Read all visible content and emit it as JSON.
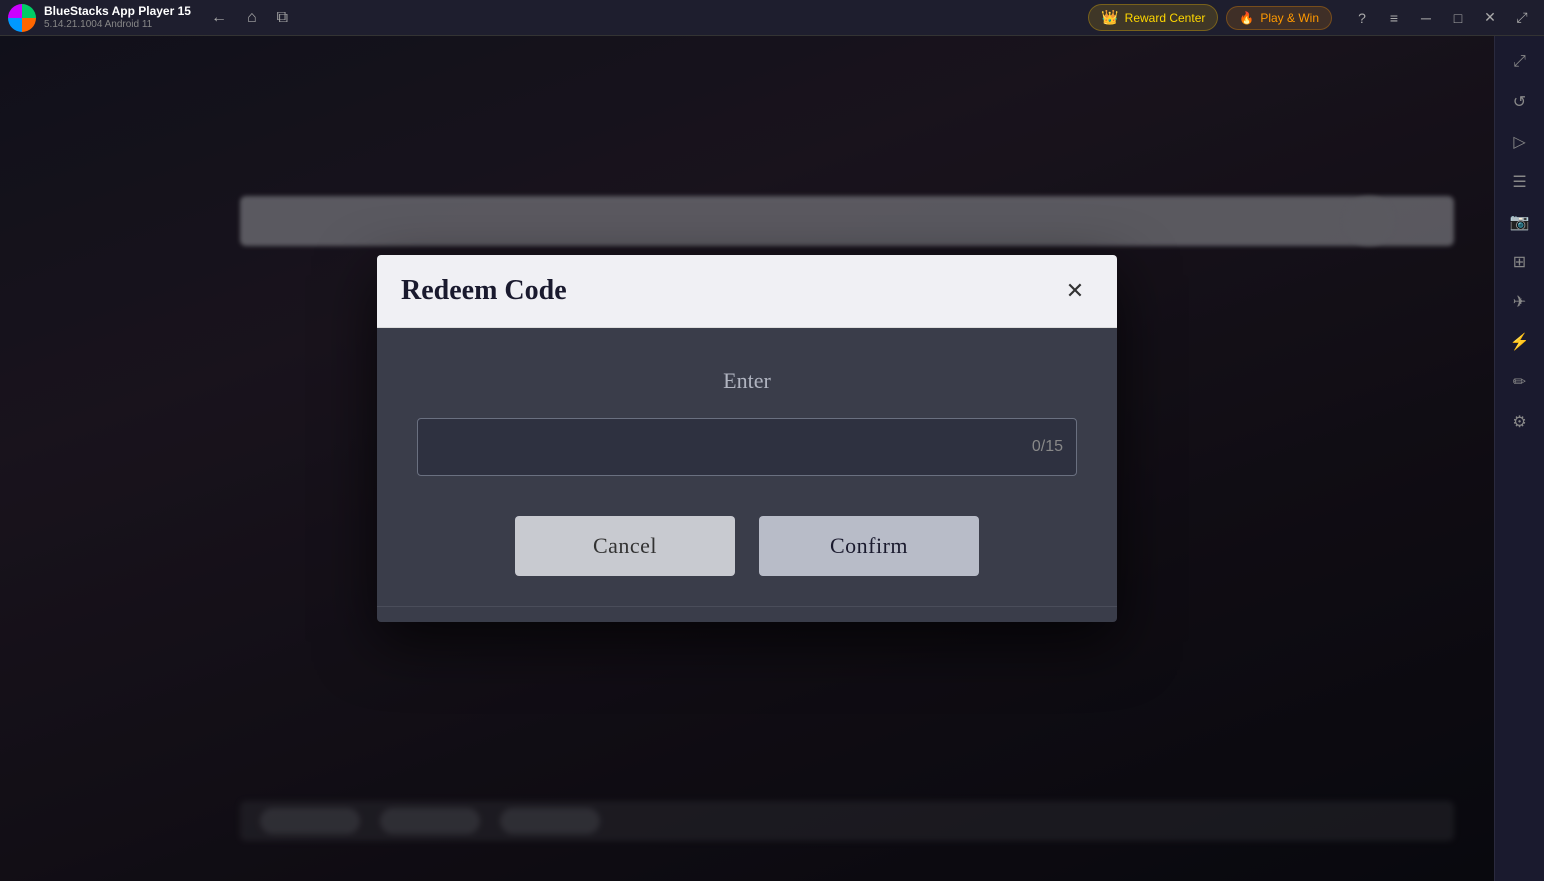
{
  "titlebar": {
    "app_name": "BlueStacks App Player 15",
    "version": "5.14.21.1004  Android 11",
    "reward_center_label": "Reward Center",
    "play_win_label": "Play & Win",
    "nav_icons": [
      "←",
      "⌂",
      "⧉"
    ],
    "ctrl_icons": [
      "?",
      "≡",
      "─",
      "□",
      "✕",
      "⤢"
    ]
  },
  "sidebar": {
    "icons": [
      "⤢",
      "↺",
      "▷",
      "☰",
      "📷",
      "⊞",
      "✈",
      "⚡",
      "✏",
      "⚙"
    ]
  },
  "modal": {
    "title": "Redeem Code",
    "close_icon": "✕",
    "enter_label": "Enter",
    "input_placeholder": "",
    "input_counter": "0/15",
    "cancel_label": "Cancel",
    "confirm_label": "Confirm"
  }
}
